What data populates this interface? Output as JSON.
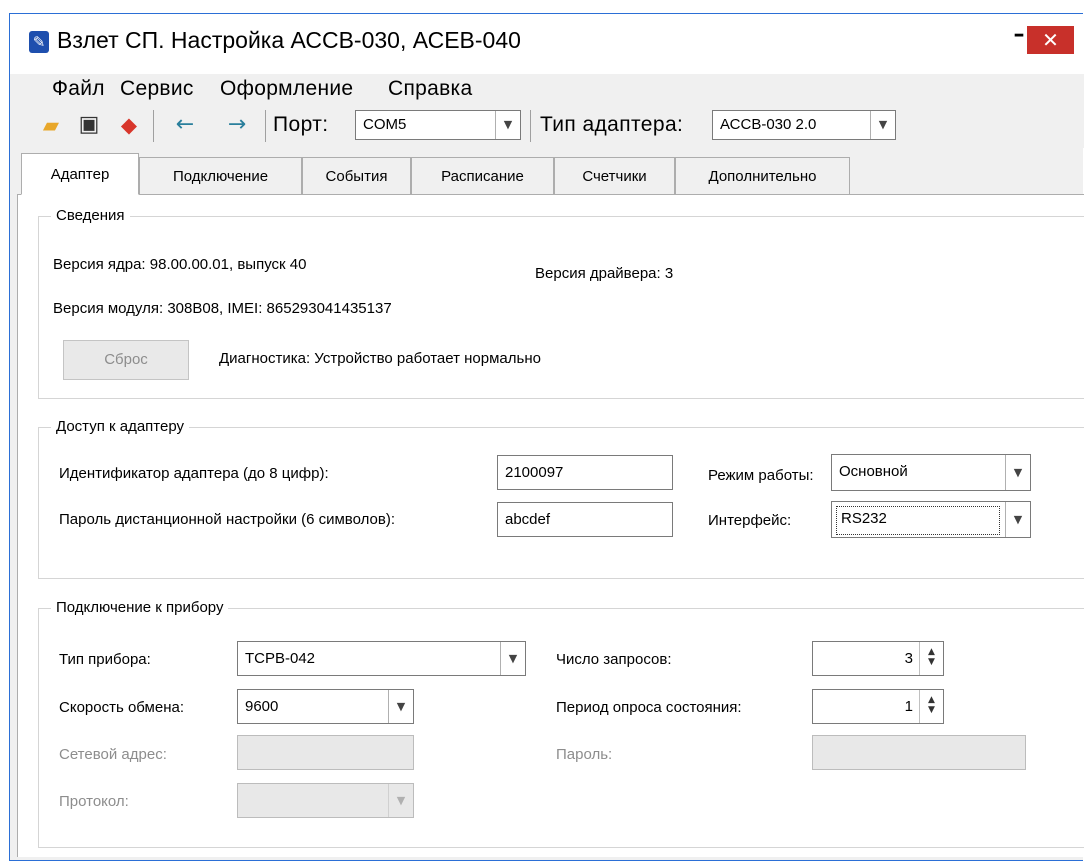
{
  "window": {
    "title": "Взлет СП. Настройка АССВ-030, АСЕВ-040",
    "minimize_glyph": "–",
    "close_glyph": "✕"
  },
  "menu": [
    "Файл",
    "Сервис",
    "Оформление",
    "Справка"
  ],
  "toolbar": {
    "icons": [
      "open-folder-icon",
      "save-icon",
      "eraser-icon",
      "back-arrow-icon",
      "forward-arrow-icon"
    ],
    "port_label": "Порт:",
    "port_value": "COM5",
    "adapter_type_label": "Тип адаптера:",
    "adapter_type_value": "АССВ-030 2.0"
  },
  "tabs": [
    "Адаптер",
    "Подключение",
    "События",
    "Расписание",
    "Счетчики",
    "Дополнительно"
  ],
  "active_tab": "Адаптер",
  "info": {
    "title": "Сведения",
    "core_version": "Версия ядра: 98.00.00.01, выпуск 40",
    "driver_version": "Версия драйвера: 3",
    "module_version": "Версия модуля: 308B08, IMEI: 865293041435137",
    "reset_button": "Сброс",
    "diagnostics": "Диагностика: Устройство работает нормально"
  },
  "access": {
    "title": "Доступ к адаптеру",
    "id_label": "Идентификатор адаптера (до 8 цифр):",
    "id_value": "2100097",
    "password_label": "Пароль дистанционной настройки (6 символов):",
    "password_value": "abcdef",
    "mode_label": "Режим работы:",
    "mode_value": "Основной",
    "interface_label": "Интерфейс:",
    "interface_value": "RS232"
  },
  "device": {
    "title": "Подключение к прибору",
    "type_label": "Тип прибора:",
    "type_value": "ТСРВ-042",
    "speed_label": "Скорость обмена:",
    "speed_value": "9600",
    "net_address_label": "Сетевой адрес:",
    "net_address_value": "",
    "protocol_label": "Протокол:",
    "protocol_value": "",
    "requests_label": "Число запросов:",
    "requests_value": "3",
    "poll_period_label": "Период опроса состояния:",
    "poll_period_value": "1",
    "password_label": "Пароль:",
    "password_value": ""
  }
}
